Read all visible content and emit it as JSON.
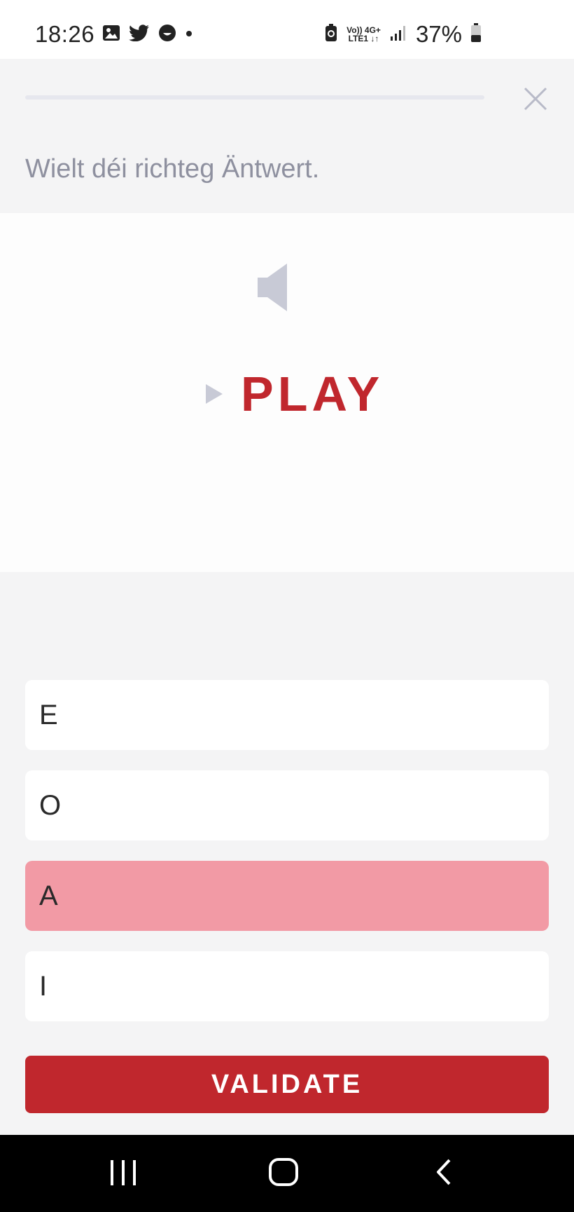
{
  "status_bar": {
    "time": "18:26",
    "battery": "37%",
    "network_top": "Vo)) 4G+",
    "network_bottom": "LTE1 ↓↑",
    "icons": [
      "image-icon",
      "twitter-icon",
      "smiley-icon",
      "dot-icon",
      "battery-saver-icon",
      "signal-icon",
      "battery-icon"
    ]
  },
  "header": {
    "instruction": "Wielt déi richteg Äntwert.",
    "progress": 0
  },
  "media": {
    "play_label": "PLAY"
  },
  "answers": {
    "options": [
      {
        "label": "E",
        "selected": false
      },
      {
        "label": "O",
        "selected": false
      },
      {
        "label": "A",
        "selected": true
      },
      {
        "label": "I",
        "selected": false
      }
    ],
    "validate_label": "VALIDATE"
  },
  "colors": {
    "accent": "#c0272d",
    "selected_option": "#f29aa5",
    "muted_icon": "#c8cad6",
    "instruction_text": "#8e909f"
  }
}
